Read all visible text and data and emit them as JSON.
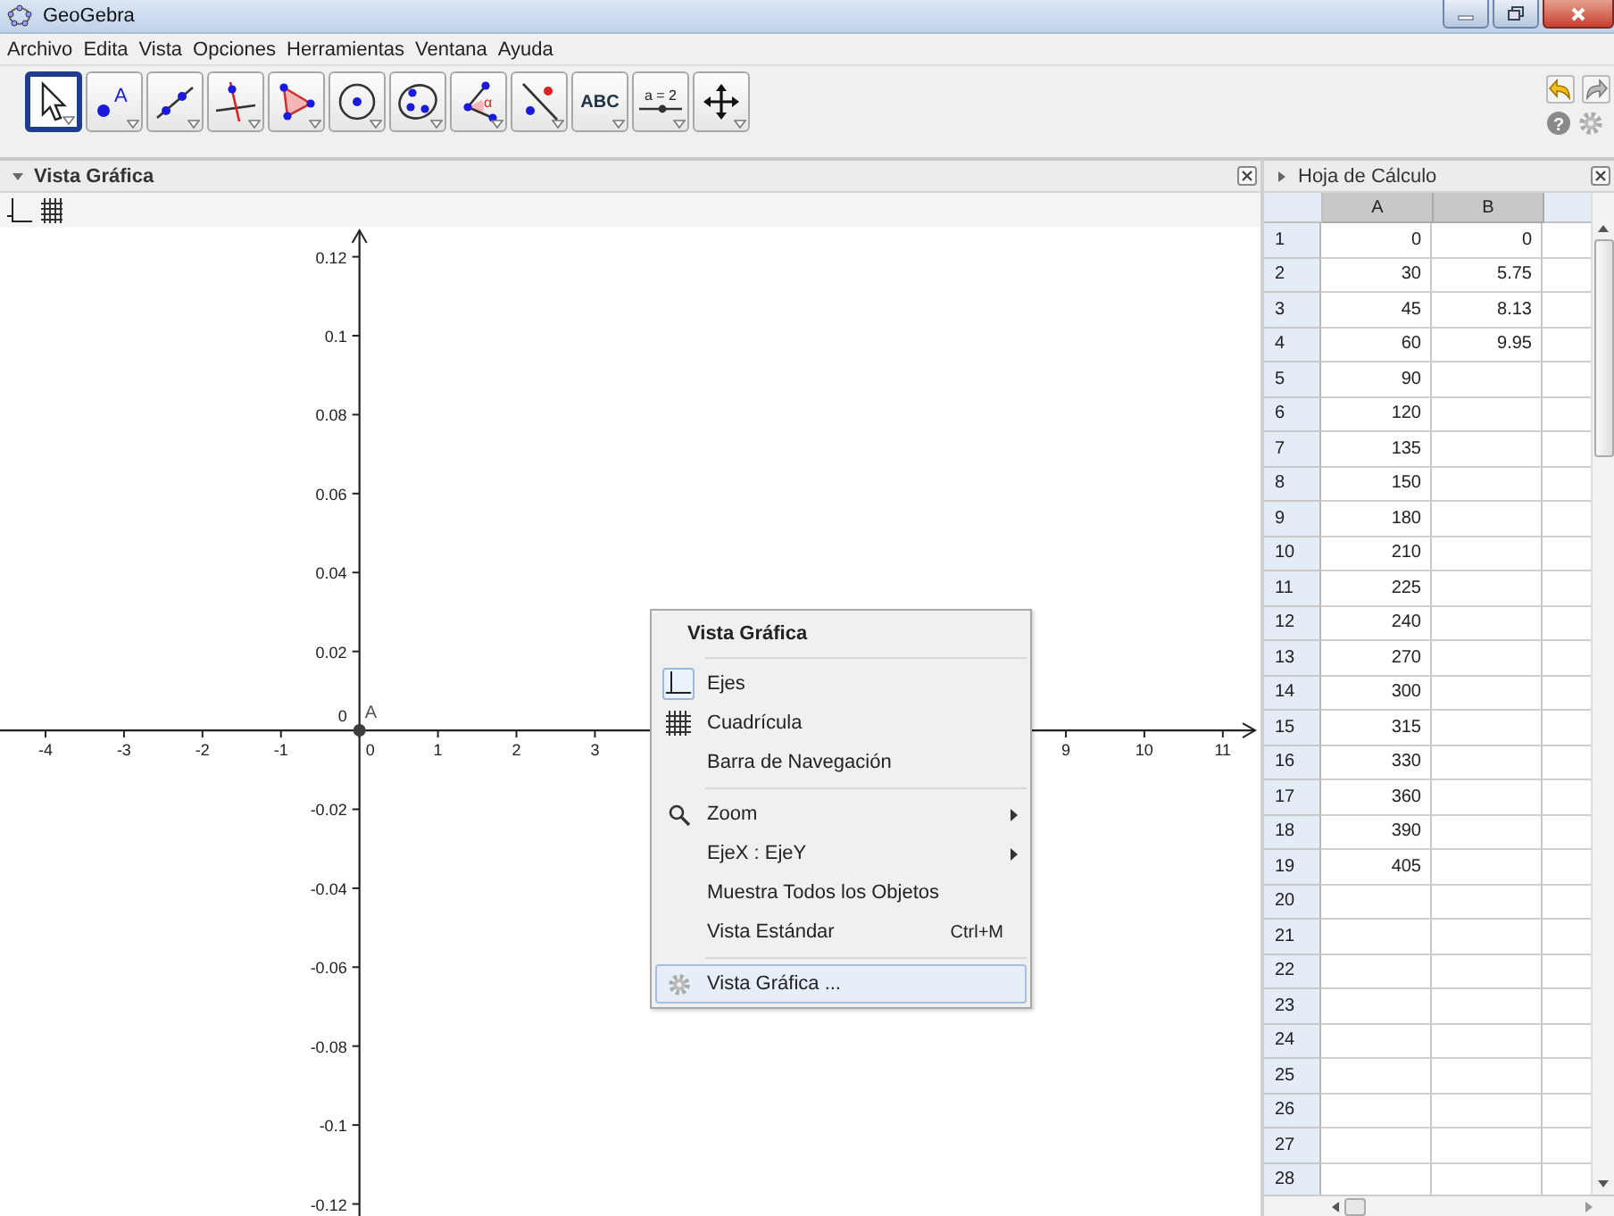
{
  "window": {
    "title": "GeoGebra"
  },
  "menu_bar": [
    "Archivo",
    "Edita",
    "Vista",
    "Opciones",
    "Herramientas",
    "Ventana",
    "Ayuda"
  ],
  "toolbar": {
    "tools": [
      {
        "kind": "move",
        "selected": true
      },
      {
        "kind": "point",
        "label": "A",
        "selected": false
      },
      {
        "kind": "line",
        "selected": false
      },
      {
        "kind": "perpendicular",
        "selected": false
      },
      {
        "kind": "polygon",
        "selected": false
      },
      {
        "kind": "circle",
        "selected": false
      },
      {
        "kind": "conic",
        "selected": false
      },
      {
        "kind": "angle",
        "label": "α",
        "selected": false
      },
      {
        "kind": "reflect",
        "selected": false
      },
      {
        "kind": "text",
        "label": "ABC",
        "selected": false
      },
      {
        "kind": "slider",
        "label": "a = 2",
        "selected": false
      },
      {
        "kind": "pan",
        "selected": false
      }
    ],
    "help_glyph": "?"
  },
  "graphics_view": {
    "title": "Vista Gráfica",
    "expanded": true,
    "origin_label": "0",
    "chart_data": {
      "type": "scatter",
      "xlim": [
        -4.58,
        11.48
      ],
      "ylim": [
        -0.1235,
        0.1276
      ],
      "xticks": [
        -4,
        -3,
        -2,
        -1,
        0,
        1,
        2,
        3,
        9,
        10,
        11
      ],
      "yticks": [
        -0.12,
        -0.1,
        -0.08,
        -0.06,
        -0.04,
        -0.02,
        0.02,
        0.04,
        0.06,
        0.08,
        0.1,
        0.12
      ],
      "x": [
        0
      ],
      "series": [
        {
          "name": "A",
          "color": "#3c3c3c",
          "values": [
            0
          ]
        }
      ]
    },
    "context_menu": {
      "title": "Vista Gráfica",
      "items": [
        {
          "kind": "axes",
          "label": "Ejes",
          "checked": true,
          "submenu": false,
          "highlighted": false
        },
        {
          "kind": "grid",
          "label": "Cuadrícula",
          "checked": false,
          "submenu": false,
          "highlighted": false
        },
        {
          "kind": "plain",
          "label": "Barra de Navegación",
          "submenu": false,
          "highlighted": false
        },
        {
          "kind": "separator"
        },
        {
          "kind": "zoom",
          "label": "Zoom",
          "submenu": true,
          "highlighted": false
        },
        {
          "kind": "plain",
          "label": "EjeX : EjeY",
          "submenu": true,
          "highlighted": false
        },
        {
          "kind": "plain",
          "label": "Muestra Todos los Objetos",
          "submenu": false,
          "highlighted": false
        },
        {
          "kind": "plain",
          "label": "Vista Estándar",
          "shortcut": "Ctrl+M",
          "submenu": false,
          "highlighted": false
        },
        {
          "kind": "separator"
        },
        {
          "kind": "settings",
          "label": "Vista Gráfica ...",
          "submenu": false,
          "highlighted": true
        }
      ]
    }
  },
  "spreadsheet": {
    "title": "Hoja de Cálculo",
    "expanded": false,
    "columns": [
      "A",
      "B"
    ],
    "rows": [
      {
        "row": "1",
        "a": "0",
        "b": "0"
      },
      {
        "row": "2",
        "a": "30",
        "b": "5.75"
      },
      {
        "row": "3",
        "a": "45",
        "b": "8.13"
      },
      {
        "row": "4",
        "a": "60",
        "b": "9.95"
      },
      {
        "row": "5",
        "a": "90"
      },
      {
        "row": "6",
        "a": "120"
      },
      {
        "row": "7",
        "a": "135"
      },
      {
        "row": "8",
        "a": "150"
      },
      {
        "row": "9",
        "a": "180"
      },
      {
        "row": "10",
        "a": "210"
      },
      {
        "row": "11",
        "a": "225"
      },
      {
        "row": "12",
        "a": "240"
      },
      {
        "row": "13",
        "a": "270"
      },
      {
        "row": "14",
        "a": "300"
      },
      {
        "row": "15",
        "a": "315"
      },
      {
        "row": "16",
        "a": "330"
      },
      {
        "row": "17",
        "a": "360"
      },
      {
        "row": "18",
        "a": "390"
      },
      {
        "row": "19",
        "a": "405"
      },
      {
        "row": "20"
      },
      {
        "row": "21"
      },
      {
        "row": "22"
      },
      {
        "row": "23"
      },
      {
        "row": "24"
      },
      {
        "row": "25"
      },
      {
        "row": "26"
      },
      {
        "row": "27"
      },
      {
        "row": "28"
      }
    ]
  }
}
